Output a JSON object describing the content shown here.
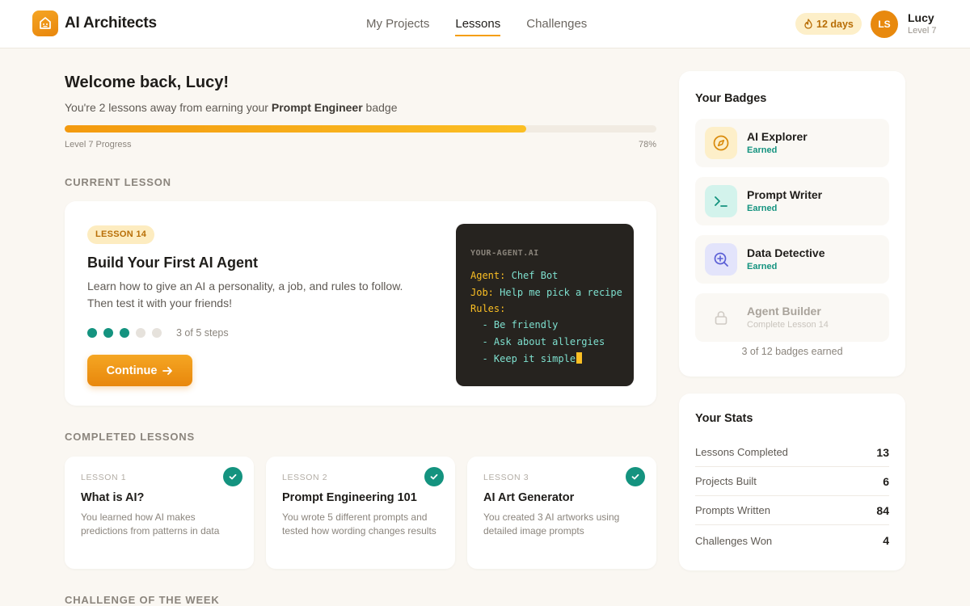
{
  "brand": {
    "name": "AI Architects",
    "icon": "home-robot-icon",
    "accent": "#f59e0b"
  },
  "nav": {
    "items": [
      {
        "label": "My Projects",
        "active": false
      },
      {
        "label": "Lessons",
        "active": true
      },
      {
        "label": "Challenges",
        "active": false
      }
    ]
  },
  "user": {
    "streak": "12 days",
    "initials": "LS",
    "name": "Lucy",
    "level": "Level 7"
  },
  "welcome": {
    "title": "Welcome back, Lucy!",
    "subtitle_pre": "You're 2 lessons away from earning your ",
    "subtitle_badge": "Prompt Engineer",
    "subtitle_post": " badge"
  },
  "progress": {
    "label": "Level 7 Progress",
    "percent_text": "78%",
    "percent": 78
  },
  "sections": {
    "current": "CURRENT LESSON",
    "completed": "COMPLETED LESSONS",
    "challenge": "CHALLENGE OF THE WEEK"
  },
  "current_lesson": {
    "badge": "LESSON 14",
    "title": "Build Your First AI Agent",
    "description": "Learn how to give an AI a personality, a job, and rules to follow. Then test it with your friends!",
    "steps_text": "3 of 5 steps",
    "steps_done": 3,
    "steps_total": 5,
    "button": "Continue"
  },
  "code": {
    "filename": "YOUR-AGENT.AI",
    "agent_key": "Agent:",
    "agent_val": "Chef Bot",
    "job_key": "Job:",
    "job_val": "Help me pick a recipe",
    "rules_key": "Rules:",
    "rule1": "  - Be friendly",
    "rule2": "  - Ask about allergies",
    "rule3": "  - Keep it simple"
  },
  "completed": [
    {
      "eyebrow": "LESSON 1",
      "title": "What is AI?",
      "desc": "You learned how AI makes predictions from patterns in data"
    },
    {
      "eyebrow": "LESSON 2",
      "title": "Prompt Engineering 101",
      "desc": "You wrote 5 different prompts and tested how wording changes results"
    },
    {
      "eyebrow": "LESSON 3",
      "title": "AI Art Generator",
      "desc": "You created 3 AI artworks using detailed image prompts"
    }
  ],
  "badges": {
    "title": "Your Badges",
    "items": [
      {
        "name": "AI Explorer",
        "status": "Earned",
        "icon": "compass-icon",
        "bg": "#fdefc9",
        "fg": "#d98a0a"
      },
      {
        "name": "Prompt Writer",
        "status": "Earned",
        "icon": "terminal-icon",
        "bg": "#d3f3ec",
        "fg": "#14937f"
      },
      {
        "name": "Data Detective",
        "status": "Earned",
        "icon": "magnify-plus-icon",
        "bg": "#e3e4fb",
        "fg": "#5b5fd6"
      },
      {
        "name": "Agent Builder",
        "status": "Complete Lesson 14",
        "icon": "lock-icon",
        "bg": "#faf8f4",
        "fg": "#cfcac3"
      }
    ],
    "summary": "3 of 12 badges earned"
  },
  "stats": {
    "title": "Your Stats",
    "items": [
      {
        "label": "Lessons Completed",
        "value": "13"
      },
      {
        "label": "Projects Built",
        "value": "6"
      },
      {
        "label": "Prompts Written",
        "value": "84"
      },
      {
        "label": "Challenges Won",
        "value": "4"
      }
    ]
  }
}
